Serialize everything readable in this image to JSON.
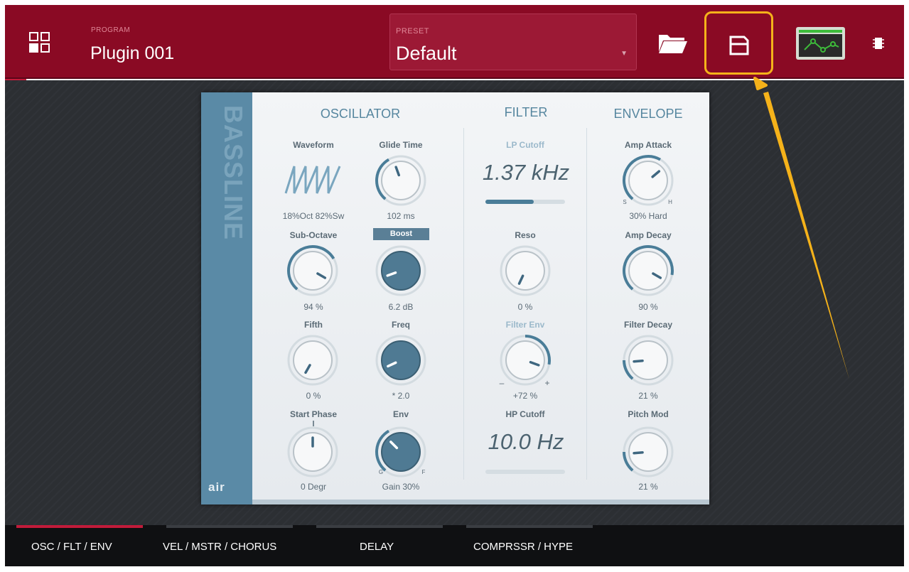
{
  "header": {
    "program_label": "PROGRAM",
    "program_name": "Plugin 001",
    "preset_label": "PRESET",
    "preset_value": "Default"
  },
  "plugin": {
    "name": "BASSLINE",
    "logo": "air",
    "sections": {
      "oscillator": "OSCILLATOR",
      "filter": "FILTER",
      "envelope": "ENVELOPE"
    },
    "oscillator": {
      "waveform_label": "Waveform",
      "waveform_value": "18%Oct 82%Sw",
      "glide_label": "Glide Time",
      "glide_value": "102 ms",
      "sub_octave_label": "Sub-Octave",
      "sub_octave_value": "94 %",
      "boost_label": "Boost",
      "boost_value": "6.2 dB",
      "fifth_label": "Fifth",
      "fifth_value": "0 %",
      "freq_label": "Freq",
      "freq_value": "* 2.0",
      "start_phase_label": "Start Phase",
      "start_phase_value": "0 Degr",
      "env_label": "Env",
      "env_value": "Gain 30%",
      "env_marks": [
        "G",
        "F"
      ]
    },
    "filter": {
      "lp_cutoff_label": "LP Cutoff",
      "lp_cutoff_value": "1.37 kHz",
      "lp_cutoff_level": 0.61,
      "reso_label": "Reso",
      "reso_value": "0 %",
      "filter_env_label": "Filter Env",
      "filter_env_value": "+72 %",
      "filter_env_marks": [
        "–",
        "+"
      ],
      "hp_cutoff_label": "HP Cutoff",
      "hp_cutoff_value": "10.0 Hz",
      "hp_cutoff_level": 0.0
    },
    "envelope": {
      "amp_attack_label": "Amp Attack",
      "amp_attack_value": "30% Hard",
      "amp_attack_marks": [
        "S",
        "H"
      ],
      "amp_decay_label": "Amp Decay",
      "amp_decay_value": "90 %",
      "filter_decay_label": "Filter Decay",
      "filter_decay_value": "21 %",
      "pitch_mod_label": "Pitch Mod",
      "pitch_mod_value": "21 %"
    }
  },
  "tabs": [
    {
      "label": "OSC / FLT / ENV",
      "active": true
    },
    {
      "label": "VEL / MSTR / CHORUS",
      "active": false
    },
    {
      "label": "DELAY",
      "active": false
    },
    {
      "label": "COMPRSSR / HYPE",
      "active": false
    }
  ],
  "icons": {
    "grid": "grid-icon",
    "folder": "folder-icon",
    "save": "save-icon",
    "envelope_editor": "envelope-editor-icon",
    "chip": "chip-icon"
  },
  "colors": {
    "header_bg": "#8a0a24",
    "highlight": "#f5b21a",
    "accent_blue": "#56869f",
    "active_tab": "#c21b3a"
  }
}
